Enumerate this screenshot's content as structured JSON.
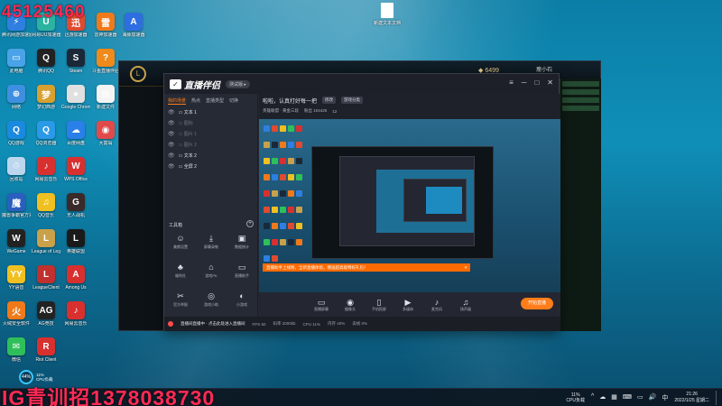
{
  "overlay": {
    "stream_id": "45125460",
    "promo": "IG青训招13780387​30"
  },
  "desktop_icons": [
    {
      "label": "腾讯网游加速器",
      "color": "#2f7fe0",
      "glyph": "⚡"
    },
    {
      "label": "网易UU加速器",
      "color": "#2bb3a2",
      "glyph": "U"
    },
    {
      "label": "迅游加速器",
      "color": "#e04a2f",
      "glyph": "迅"
    },
    {
      "label": "雷神加速器",
      "color": "#f07a1a",
      "glyph": "雷"
    },
    {
      "label": "海豚加速器",
      "color": "#2f6ee0",
      "glyph": "A"
    },
    {
      "label": "此电脑",
      "color": "#4aa3e8",
      "glyph": "▭"
    },
    {
      "label": "腾讯QQ",
      "color": "#222222",
      "glyph": "Q"
    },
    {
      "label": "Steam",
      "color": "#1b2838",
      "glyph": "S"
    },
    {
      "label": "斗鱼直播伴侣",
      "color": "#f08a1a",
      "glyph": "?"
    },
    {
      "label": "网络",
      "color": "#3f8fe0",
      "glyph": "⊕"
    },
    {
      "label": "梦幻西游",
      "color": "#d8a030",
      "glyph": "梦"
    },
    {
      "label": "Google Chrome",
      "color": "#e0e0e0",
      "glyph": "●"
    },
    {
      "label": "新建文件",
      "color": "#f4f4f4",
      "glyph": "▤"
    },
    {
      "label": "QQ游戏",
      "color": "#1a8ae0",
      "glyph": "Q"
    },
    {
      "label": "QQ浏览器",
      "color": "#2a9ae8",
      "glyph": "Q"
    },
    {
      "label": "百度网盘",
      "color": "#2a7fe8",
      "glyph": "☁"
    },
    {
      "label": "大富翁",
      "color": "#e04a4a",
      "glyph": "◉"
    },
    {
      "label": "回收站",
      "color": "#bcd6ee",
      "glyph": "♲"
    },
    {
      "label": "网易云音乐",
      "color": "#d8302f",
      "glyph": "♪"
    },
    {
      "label": "WPS Office",
      "color": "#d8302f",
      "glyph": "W"
    },
    {
      "label": "魔兽争霸官方对战平台",
      "color": "#2a5fbf",
      "glyph": "魔"
    },
    {
      "label": "QQ音乐",
      "color": "#f0c020",
      "glyph": "♫"
    },
    {
      "label": "无人战机",
      "color": "#3a2a2a",
      "glyph": "G"
    },
    {
      "label": "WeGame",
      "color": "#222222",
      "glyph": "W"
    },
    {
      "label": "League of Legends",
      "color": "#c8a14a",
      "glyph": "L"
    },
    {
      "label": "英雄联盟",
      "color": "#1a1a1a",
      "glyph": "L"
    },
    {
      "label": "YY语音",
      "color": "#f0c020",
      "glyph": "YY"
    },
    {
      "label": "LeagueClient",
      "color": "#c0302f",
      "glyph": "L"
    },
    {
      "label": "Among Us",
      "color": "#d8302f",
      "glyph": "A"
    },
    {
      "label": "火绒安全软件",
      "color": "#f07a1a",
      "glyph": "火"
    },
    {
      "label": "AG竞技",
      "color": "#222222",
      "glyph": "AG"
    },
    {
      "label": "网易云音乐",
      "color": "#d8302f",
      "glyph": "♪"
    },
    {
      "label": "微信",
      "color": "#2fbf5a",
      "glyph": "✉"
    },
    {
      "label": "Riot Client",
      "color": "#d8302f",
      "glyph": "R"
    }
  ],
  "desktop_file": {
    "label": "新建文本文档"
  },
  "cpu_widget": {
    "percent": "44%",
    "label1": "11%",
    "label2": "CPU负载"
  },
  "game_window": {
    "coins": "6499",
    "user": "瘦小石",
    "logo": "L"
  },
  "app": {
    "name": "直播伴侣",
    "version": "测试版",
    "controls": {
      "min": "─",
      "max": "□",
      "close": "✕",
      "menu": "≡"
    },
    "tabs": [
      "我的场景",
      "热点",
      "直播类型",
      "切换"
    ],
    "scenes": [
      {
        "name": "文本 1",
        "dim": false
      },
      {
        "name": "图标",
        "dim": true
      },
      {
        "name": "图片 1",
        "dim": true
      },
      {
        "name": "图片 2",
        "dim": true
      },
      {
        "name": "文本 2",
        "dim": false
      },
      {
        "name": "全屏 2",
        "dim": false
      }
    ],
    "tools_title": "工具箱",
    "tools": [
      {
        "label": "美颜设置",
        "icon": "☺"
      },
      {
        "label": "屏幕录制",
        "icon": "⤓"
      },
      {
        "label": "数据统计",
        "icon": "▣"
      },
      {
        "label": "福利社",
        "icon": "♣"
      },
      {
        "label": "游戏PK",
        "icon": "⌂"
      },
      {
        "label": "直播助手",
        "icon": "▭"
      },
      {
        "label": "官方举报",
        "icon": "✂"
      },
      {
        "label": "游戏小助",
        "icon": "◎"
      },
      {
        "label": "小游戏",
        "icon": "◐"
      }
    ],
    "room": {
      "title": "啦啦，认真打好每一把",
      "edit": "修改",
      "category": "游戏分类",
      "tag": "英雄联盟",
      "sub1": "英雄联盟 · 黄金三段",
      "sub2": "粉丝 104425",
      "sub3": "12"
    },
    "toast": "直播助手上线啦，全新直播体验，赠送超高级特权礼包！",
    "toast_close": "✕",
    "bottom": [
      {
        "label": "直播屏幕",
        "icon": "▭"
      },
      {
        "label": "摄像头",
        "icon": "◉"
      },
      {
        "label": "手机投屏",
        "icon": "▯"
      },
      {
        "label": "多媒体",
        "icon": "▶"
      },
      {
        "label": "麦克风",
        "icon": "♪"
      },
      {
        "label": "扬声器",
        "icon": "♫"
      }
    ],
    "live_button": "开始直播",
    "status": {
      "notice": "直播间直播中 · 点击此处进入直播间",
      "fps": "FPS 60",
      "bitrate": "码率 2000kb",
      "cpu": "CPU 11%",
      "mem": "内存 40%",
      "drop": "丢帧 0%"
    }
  },
  "taskbar": {
    "cpu": "11%",
    "cpu_label": "CPU负载",
    "time": "21:26",
    "date": "2022/1/25 星期二",
    "tray_icons": [
      "^",
      "☁",
      "▦",
      "⌨",
      "▭",
      "🔊",
      "中"
    ]
  }
}
